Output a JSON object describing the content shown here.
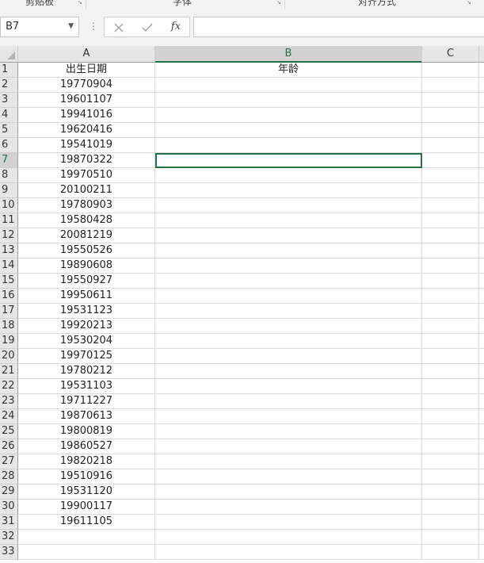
{
  "ribbon": {
    "groups": [
      {
        "label": "剪贴板"
      },
      {
        "label": "字体"
      },
      {
        "label": "对齐方式"
      }
    ]
  },
  "formula_bar": {
    "name_box": "B7",
    "cancel_icon": "close-icon",
    "enter_icon": "check-icon",
    "fx_label": "fx",
    "formula": ""
  },
  "sheet": {
    "columns": [
      "A",
      "B",
      "C"
    ],
    "selected_cell": "B7",
    "rows": [
      {
        "n": "1",
        "a": "出生日期",
        "b": "年龄"
      },
      {
        "n": "2",
        "a": "19770904",
        "b": ""
      },
      {
        "n": "3",
        "a": "19601107",
        "b": ""
      },
      {
        "n": "4",
        "a": "19941016",
        "b": ""
      },
      {
        "n": "5",
        "a": "19620416",
        "b": ""
      },
      {
        "n": "6",
        "a": "19541019",
        "b": ""
      },
      {
        "n": "7",
        "a": "19870322",
        "b": ""
      },
      {
        "n": "8",
        "a": "19970510",
        "b": ""
      },
      {
        "n": "9",
        "a": "20100211",
        "b": ""
      },
      {
        "n": "10",
        "a": "19780903",
        "b": ""
      },
      {
        "n": "11",
        "a": "19580428",
        "b": ""
      },
      {
        "n": "12",
        "a": "20081219",
        "b": ""
      },
      {
        "n": "13",
        "a": "19550526",
        "b": ""
      },
      {
        "n": "14",
        "a": "19890608",
        "b": ""
      },
      {
        "n": "15",
        "a": "19550927",
        "b": ""
      },
      {
        "n": "16",
        "a": "19950611",
        "b": ""
      },
      {
        "n": "17",
        "a": "19531123",
        "b": ""
      },
      {
        "n": "18",
        "a": "19920213",
        "b": ""
      },
      {
        "n": "19",
        "a": "19530204",
        "b": ""
      },
      {
        "n": "20",
        "a": "19970125",
        "b": ""
      },
      {
        "n": "21",
        "a": "19780212",
        "b": ""
      },
      {
        "n": "22",
        "a": "19531103",
        "b": ""
      },
      {
        "n": "23",
        "a": "19711227",
        "b": ""
      },
      {
        "n": "24",
        "a": "19870613",
        "b": ""
      },
      {
        "n": "25",
        "a": "19800819",
        "b": ""
      },
      {
        "n": "26",
        "a": "19860527",
        "b": ""
      },
      {
        "n": "27",
        "a": "19820218",
        "b": ""
      },
      {
        "n": "28",
        "a": "19510916",
        "b": ""
      },
      {
        "n": "29",
        "a": "19531120",
        "b": ""
      },
      {
        "n": "30",
        "a": "19900117",
        "b": ""
      },
      {
        "n": "31",
        "a": "19611105",
        "b": ""
      },
      {
        "n": "32",
        "a": "",
        "b": ""
      },
      {
        "n": "33",
        "a": "",
        "b": ""
      }
    ]
  },
  "colors": {
    "accent": "#217346",
    "header_bg": "#e6e6e6",
    "gridline": "#dadada"
  }
}
